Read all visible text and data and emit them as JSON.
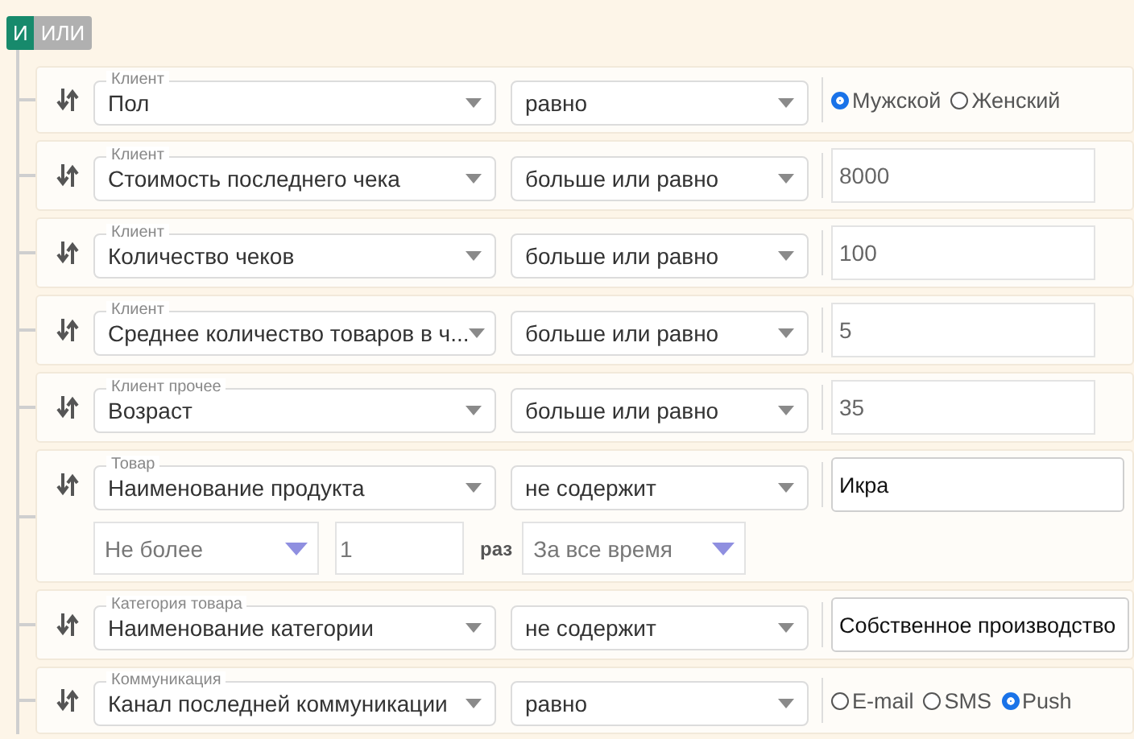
{
  "logic_toggle": [
    {
      "label": "И",
      "selected": true
    },
    {
      "label": "ИЛИ",
      "selected": false
    }
  ],
  "conditions": [
    {
      "group": "Клиент",
      "field": "Пол",
      "operator": "равно",
      "kind": "radio",
      "options": [
        {
          "label": "Мужской",
          "selected": true
        },
        {
          "label": "Женский",
          "selected": false
        }
      ]
    },
    {
      "group": "Клиент",
      "field": "Стоимость последнего чека",
      "operator": "больше или равно",
      "kind": "number",
      "value": "8000"
    },
    {
      "group": "Клиент",
      "field": "Количество чеков",
      "operator": "больше или равно",
      "kind": "number",
      "value": "100"
    },
    {
      "group": "Клиент",
      "field": "Среднее количество товаров в ч...",
      "operator": "больше или равно",
      "kind": "number",
      "value": "5"
    },
    {
      "group": "Клиент прочее",
      "field": "Возраст",
      "operator": "больше или равно",
      "kind": "number",
      "value": "35"
    },
    {
      "group": "Товар",
      "field": "Наименование продукта",
      "operator": "не содержит",
      "kind": "text",
      "value": "Икра",
      "frequency": {
        "limit": "Не более",
        "count": "1",
        "unit": "раз",
        "period": "За все время"
      }
    },
    {
      "group": "Категория товара",
      "field": "Наименование категории",
      "operator": "не содержит",
      "kind": "text",
      "value": "Собственное производство"
    },
    {
      "group": "Коммуникация",
      "field": "Канал последней коммуникации",
      "operator": "равно",
      "kind": "radio",
      "options": [
        {
          "label": "E-mail",
          "selected": false
        },
        {
          "label": "SMS",
          "selected": false
        },
        {
          "label": "Push",
          "selected": true
        }
      ]
    }
  ]
}
